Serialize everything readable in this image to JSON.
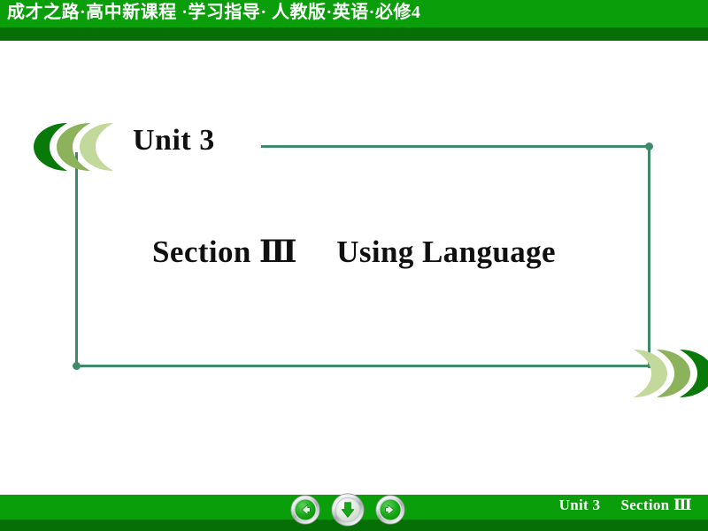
{
  "header": {
    "title": "成才之路·高中新课程 ·学习指导· 人教版·英语·必修4",
    "bright_color": "#0a9e0a",
    "dark_color": "#067006",
    "text_color": "#ffffff"
  },
  "slide": {
    "unit_label": "Unit 3",
    "section_label": "Section Ⅲ",
    "section_topic": "Using Language",
    "text_color": "#101010",
    "frame_color": "#3e8a69",
    "chevron_colors": {
      "dark": "#097a09",
      "medium": "#8cb35b",
      "light": "#c3d89b"
    },
    "decorations": {
      "chevrons_left_name": "triple-chevron-left",
      "chevrons_right_name": "triple-chevron-right",
      "corner_dot_top_right": "frame-corner-dot",
      "corner_dot_bottom_left": "frame-corner-dot"
    }
  },
  "footer": {
    "unit_label": "Unit 3",
    "section_label": "Section Ⅲ",
    "bright_color": "#0a9e0a",
    "dark_color": "#067006",
    "text_color": "#ffffff",
    "buttons": [
      {
        "name": "previous-slide-button",
        "icon": "arrow-left-icon",
        "label": "Previous"
      },
      {
        "name": "down-slide-button",
        "icon": "arrow-down-icon",
        "label": "Down"
      },
      {
        "name": "next-slide-button",
        "icon": "arrow-right-icon",
        "label": "Next"
      }
    ]
  }
}
